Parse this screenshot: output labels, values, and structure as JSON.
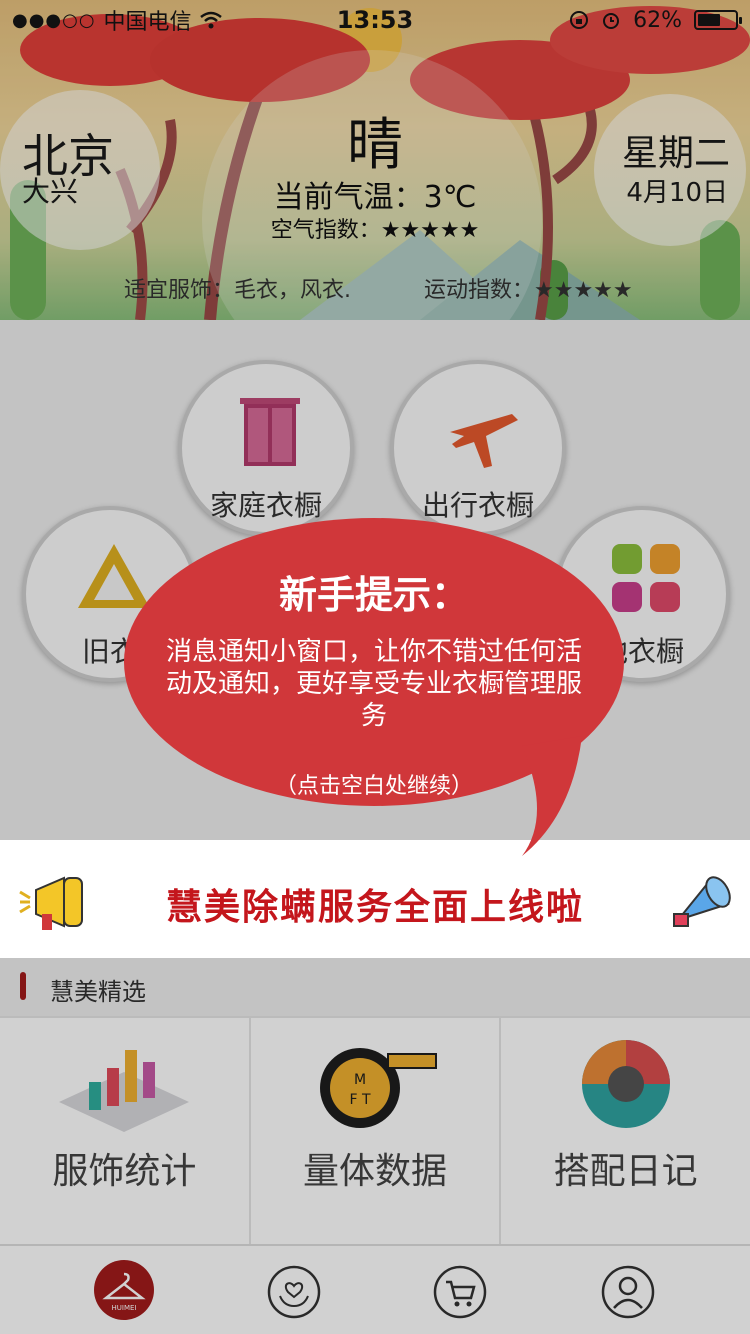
{
  "status_bar": {
    "signal": "●●●○○",
    "carrier": "中国电信",
    "time": "13:53",
    "battery_percent": "62%",
    "battery_level": 0.62
  },
  "weather": {
    "city": "北京",
    "district": "大兴",
    "condition": "晴",
    "temperature": "当前气温：3℃",
    "air_index": "空气指数：★★★★★",
    "weekday": "星期二",
    "date": "4月10日",
    "clothing": "适宜服饰：毛衣，风衣.",
    "sport_index": "运动指数：★★★★★"
  },
  "wardrobes": [
    {
      "label": "家庭衣橱",
      "icon": "closet-icon"
    },
    {
      "label": "出行衣橱",
      "icon": "airplane-icon"
    },
    {
      "label": "旧衣橱",
      "icon": "recycle-icon"
    },
    {
      "label": "其他衣橱",
      "icon": "grid-icon"
    }
  ],
  "wardrobe_visible_labels": [
    "家庭衣橱",
    "出行衣橱",
    "旧衣",
    "他衣橱"
  ],
  "banner": {
    "text": "慧美除螨服务全面上线啦",
    "left_icon": "megaphone-icon",
    "right_icon": "horn-icon"
  },
  "section": {
    "title": "慧美精选"
  },
  "features": [
    {
      "label": "服饰统计",
      "icon": "bar-chart-icon"
    },
    {
      "label": "量体数据",
      "icon": "tape-measure-icon"
    },
    {
      "label": "搭配日记",
      "icon": "outfit-wheel-icon"
    }
  ],
  "tabbar": [
    {
      "name": "home",
      "icon": "hanger-logo-icon",
      "text": "HUIMEI"
    },
    {
      "name": "care",
      "icon": "heart-hands-icon"
    },
    {
      "name": "cart",
      "icon": "cart-icon"
    },
    {
      "name": "profile",
      "icon": "user-icon"
    }
  ],
  "tip": {
    "title": "新手提示：",
    "body": "消息通知小窗口，让你不错过任何活动及通知，更好享受专业衣橱管理服务",
    "hint": "（点击空白处继续）"
  },
  "colors": {
    "bubble": "#d0373a",
    "banner_text": "#c4161c",
    "section_bar": "#a31c1c"
  }
}
